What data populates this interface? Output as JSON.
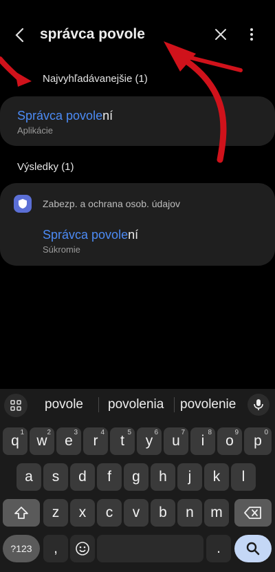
{
  "search": {
    "query": "správca povole"
  },
  "sections": {
    "top": "Najvyhľadávanejšie (1)",
    "results": "Výsledky (1)"
  },
  "top_result": {
    "title_match": "Správca povole",
    "title_rest": "ní",
    "subtitle": "Aplikácie"
  },
  "result_group": {
    "category": "Zabezp. a ochrana osob. údajov",
    "title_match": "Správca povole",
    "title_rest": "ní",
    "subtitle": "Súkromie"
  },
  "keyboard": {
    "suggestions": [
      "povole",
      "povolenia",
      "povolenie"
    ],
    "row1": [
      "q",
      "w",
      "e",
      "r",
      "t",
      "y",
      "u",
      "i",
      "o",
      "p"
    ],
    "row1_sup": [
      "1",
      "2",
      "3",
      "4",
      "5",
      "6",
      "7",
      "8",
      "9",
      "0"
    ],
    "row2": [
      "a",
      "s",
      "d",
      "f",
      "g",
      "h",
      "j",
      "k",
      "l"
    ],
    "row3": [
      "z",
      "x",
      "c",
      "v",
      "b",
      "n",
      "m"
    ],
    "symbols_label": "?123",
    "comma": ",",
    "period": "."
  },
  "colors": {
    "accent": "#4c8bf5",
    "card": "#1f1f1f",
    "annotation_arrow": "#d0121b"
  }
}
